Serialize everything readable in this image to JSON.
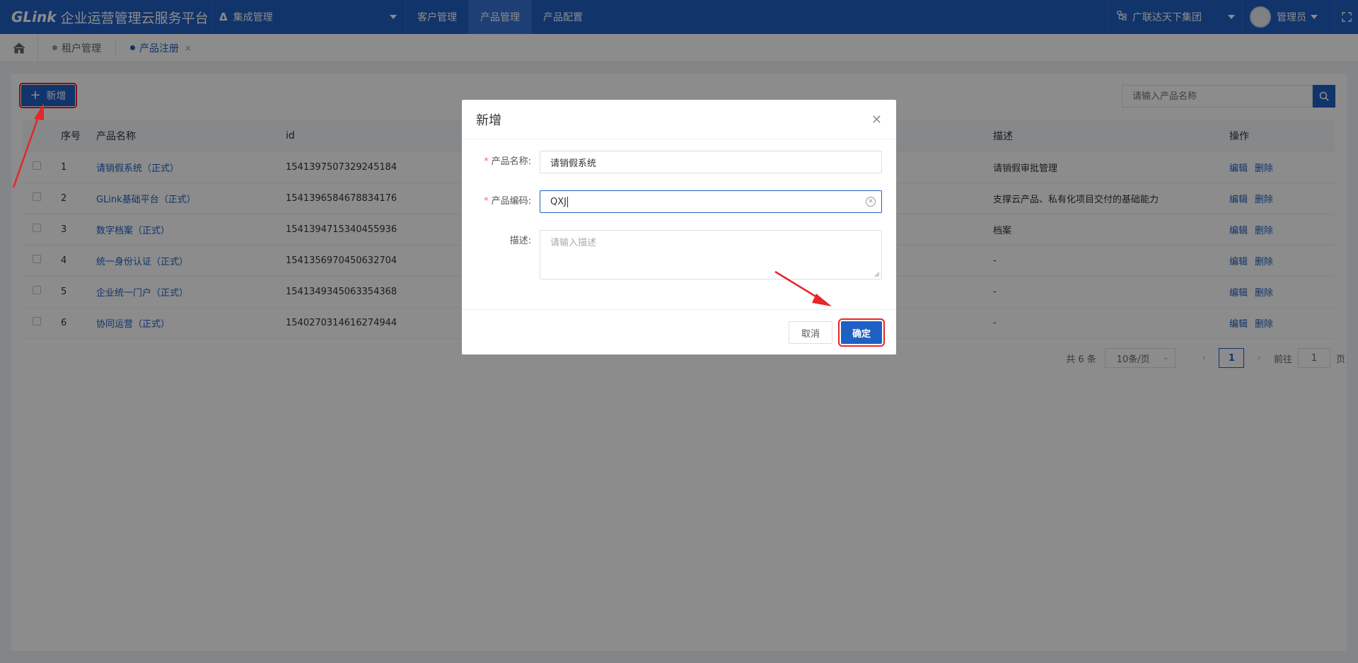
{
  "header": {
    "logo": "GLink",
    "title": "企业运营管理云服务平台",
    "integration_menu": "集成管理",
    "tabs": [
      "客户管理",
      "产品管理",
      "产品配置"
    ],
    "org": "广联达天下集团",
    "user": "管理员"
  },
  "breadcrumb": {
    "tags": [
      {
        "label": "租户管理"
      },
      {
        "label": "产品注册"
      }
    ],
    "close": "×"
  },
  "toolbar": {
    "add_label": "新增",
    "search_placeholder": "请输入产品名称"
  },
  "table": {
    "columns": [
      "序号",
      "产品名称",
      "id",
      "描述",
      "操作"
    ],
    "rows": [
      {
        "no": "1",
        "name": "请销假系统（正式）",
        "id": "1541397507329245184",
        "desc": "请销假审批管理"
      },
      {
        "no": "2",
        "name": "GLink基础平台（正式）",
        "id": "1541396584678834176",
        "desc": "支撑云产品、私有化项目交付的基础能力"
      },
      {
        "no": "3",
        "name": "数字档案（正式）",
        "id": "1541394715340455936",
        "desc": "档案"
      },
      {
        "no": "4",
        "name": "统一身份认证（正式）",
        "id": "1541356970450632704",
        "desc": "-"
      },
      {
        "no": "5",
        "name": "企业统一门户（正式）",
        "id": "1541349345063354368",
        "desc": "-"
      },
      {
        "no": "6",
        "name": "协同运营（正式）",
        "id": "1540270314616274944",
        "desc": "-"
      }
    ],
    "edit_label": "编辑",
    "delete_label": "删除"
  },
  "pagination": {
    "total_text": "共 6 条",
    "page_size": "10条/页",
    "current_page": "1",
    "goto_label": "前往",
    "goto_value": "1",
    "page_unit": "页"
  },
  "dialog": {
    "title": "新增",
    "name_label": "产品名称:",
    "name_value": "请销假系统",
    "code_label": "产品编码:",
    "code_value": "QXJ",
    "desc_label": "描述:",
    "desc_placeholder": "请输入描述",
    "cancel_label": "取消",
    "ok_label": "确定"
  },
  "colors": {
    "primary": "#1f60c4",
    "annotation": "#e5262b"
  }
}
